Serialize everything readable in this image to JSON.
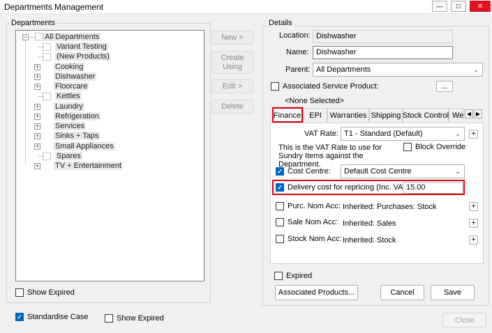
{
  "window": {
    "title": "Departments Management",
    "minimize": "—",
    "maximize": "□",
    "close": "✕"
  },
  "departments": {
    "label": "Departments",
    "root": "All Departments",
    "items": [
      {
        "label": "Variant Testing",
        "expandable": false
      },
      {
        "label": "(New Products)",
        "expandable": false
      },
      {
        "label": "Cooking",
        "expandable": true
      },
      {
        "label": "Dishwasher",
        "expandable": true
      },
      {
        "label": "Floorcare",
        "expandable": true
      },
      {
        "label": "Kettles",
        "expandable": false
      },
      {
        "label": "Laundry",
        "expandable": true
      },
      {
        "label": "Refrigeration",
        "expandable": true
      },
      {
        "label": "Services",
        "expandable": true
      },
      {
        "label": "Sinks + Taps",
        "expandable": true
      },
      {
        "label": "Small Appliances",
        "expandable": true
      },
      {
        "label": "Spares",
        "expandable": false
      },
      {
        "label": "TV + Entertainment",
        "expandable": true
      }
    ],
    "show_expired_label": "Show Expired"
  },
  "actions": {
    "new": "New >",
    "create_using": "Create Using",
    "edit": "Edit >",
    "delete": "Delete"
  },
  "details": {
    "label": "Details",
    "location_label": "Location:",
    "location_value": "Dishwasher",
    "name_label": "Name:",
    "name_value": "Dishwasher",
    "parent_label": "Parent:",
    "parent_value": "All Departments",
    "assoc_service_label": "Associated Service Product:",
    "assoc_service_button": "...",
    "none_selected": "<None Selected>",
    "tabs": [
      "Finance",
      "EPI",
      "Warranties",
      "Shipping",
      "Stock Control",
      "We"
    ],
    "finance": {
      "vat_label": "VAT Rate:",
      "vat_value": "T1 - Standard (Default)",
      "vat_note": "This is the VAT Rate to use for Sundry Items against the Department.",
      "block_override": "Block Override",
      "cost_centre_label": "Cost Centre:",
      "cost_centre_value": "Default Cost Centre",
      "delivery_label": "Delivery cost for repricing (Inc. VAT):",
      "delivery_value": "15.00",
      "purc_label": "Purc. Nom Acc:",
      "purc_value": "Inherited: Purchases: Stock",
      "sale_label": "Sale Nom Acc:",
      "sale_value": "Inherited: Sales",
      "stock_label": "Stock Nom Acc:",
      "stock_value": "Inherited: Stock",
      "plus": "+"
    },
    "expired_label": "Expired",
    "associated_products": "Associated Products...",
    "cancel": "Cancel",
    "save": "Save"
  },
  "footer": {
    "standardise_case": "Standardise Case",
    "show_expired": "Show Expired",
    "close": "Close"
  },
  "colors": {
    "highlight": "#d9000d",
    "checkbox": "#0067c0"
  }
}
